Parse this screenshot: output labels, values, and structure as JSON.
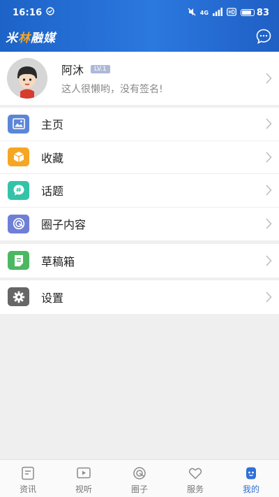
{
  "status_bar": {
    "time": "16:16",
    "network": "4G",
    "battery": "83",
    "battery_level": 0.83
  },
  "app": {
    "logo_part1": "米",
    "logo_accent": "林",
    "logo_part2": "融媒"
  },
  "profile": {
    "name": "阿沐",
    "level": "LV.1",
    "signature": "这人很懒哟，没有签名!"
  },
  "menu": {
    "group1": [
      {
        "label": "主页",
        "icon": "image-icon",
        "color": "#5b86d8"
      },
      {
        "label": "收藏",
        "icon": "box-icon",
        "color": "#f5a623"
      },
      {
        "label": "话题",
        "icon": "hashtag-icon",
        "color": "#33c3a8"
      },
      {
        "label": "圈子内容",
        "icon": "circle-icon",
        "color": "#6f7fd6"
      }
    ],
    "group2": [
      {
        "label": "草稿箱",
        "icon": "draft-icon",
        "color": "#4cb862"
      }
    ],
    "group3": [
      {
        "label": "设置",
        "icon": "gear-icon",
        "color": "#666666"
      }
    ]
  },
  "bottom_nav": [
    {
      "label": "资讯",
      "icon": "news-icon",
      "active": false
    },
    {
      "label": "视听",
      "icon": "play-icon",
      "active": false
    },
    {
      "label": "圈子",
      "icon": "circle-icon",
      "active": false
    },
    {
      "label": "服务",
      "icon": "heart-icon",
      "active": false
    },
    {
      "label": "我的",
      "icon": "face-icon",
      "active": true
    }
  ]
}
